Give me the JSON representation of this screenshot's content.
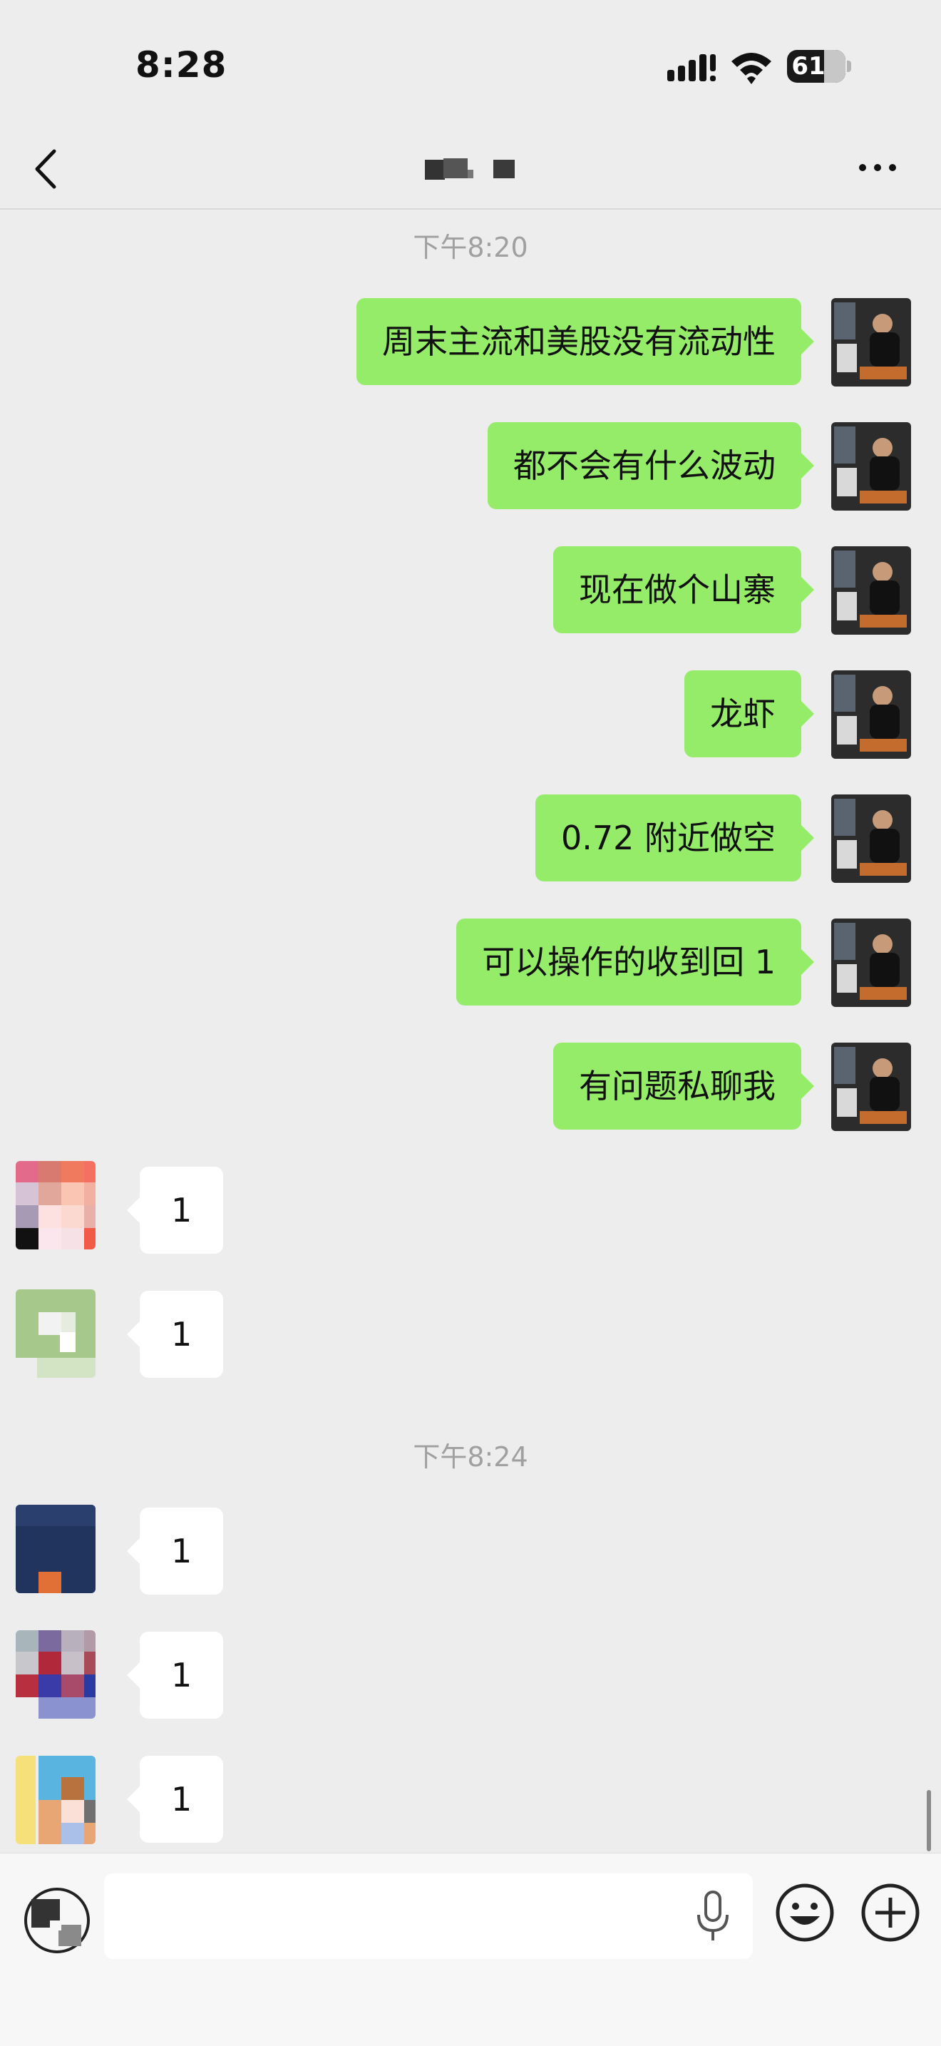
{
  "status_bar": {
    "time": "8:28",
    "battery": "61"
  },
  "nav": {
    "title": ""
  },
  "chat": {
    "timestamps": [
      "下午8:20",
      "下午8:24"
    ],
    "outgoing": [
      "周末主流和美股没有流动性",
      "都不会有什么波动",
      "现在做个山寨",
      "龙虾",
      "0.72 附近做空",
      "可以操作的收到回 1",
      "有问题私聊我"
    ],
    "incoming": [
      "1",
      "1",
      "1",
      "1",
      "1"
    ]
  },
  "colors": {
    "outgoing_bubble": "#95ec69",
    "incoming_bubble": "#ffffff",
    "background": "#ededed"
  },
  "icons": {
    "back": "chevron-left-icon",
    "more": "more-horizontal-icon",
    "voice": "voice-icon",
    "mic": "microphone-icon",
    "emoji": "emoji-icon",
    "plus": "plus-circle-icon"
  }
}
